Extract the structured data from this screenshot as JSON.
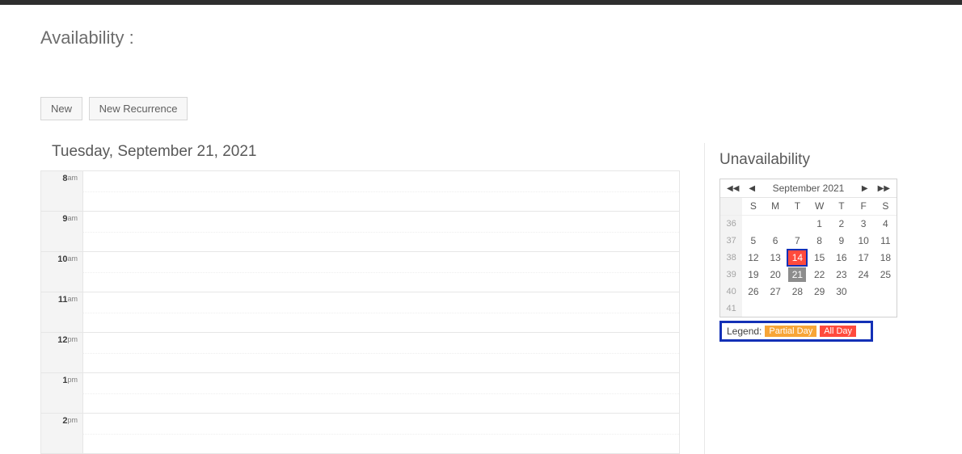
{
  "header": {
    "title": "Availability :"
  },
  "toolbar": {
    "new_label": "New",
    "new_recurrence_label": "New Recurrence"
  },
  "schedule": {
    "date_title": "Tuesday, September 21, 2021",
    "hours": [
      {
        "hour": "8",
        "ampm": "am"
      },
      {
        "hour": "9",
        "ampm": "am"
      },
      {
        "hour": "10",
        "ampm": "am"
      },
      {
        "hour": "11",
        "ampm": "am"
      },
      {
        "hour": "12",
        "ampm": "pm"
      },
      {
        "hour": "1",
        "ampm": "pm"
      },
      {
        "hour": "2",
        "ampm": "pm"
      }
    ]
  },
  "sidebar": {
    "title": "Unavailability",
    "calendar": {
      "title": "September 2021",
      "dow": [
        "S",
        "M",
        "T",
        "W",
        "T",
        "F",
        "S"
      ],
      "weeks": [
        {
          "wk": "36",
          "days": [
            "",
            "",
            "",
            "1",
            "2",
            "3",
            "4"
          ]
        },
        {
          "wk": "37",
          "days": [
            "5",
            "6",
            "7",
            "8",
            "9",
            "10",
            "11"
          ]
        },
        {
          "wk": "38",
          "days": [
            "12",
            "13",
            "14",
            "15",
            "16",
            "17",
            "18"
          ]
        },
        {
          "wk": "39",
          "days": [
            "19",
            "20",
            "21",
            "22",
            "23",
            "24",
            "25"
          ]
        },
        {
          "wk": "40",
          "days": [
            "26",
            "27",
            "28",
            "29",
            "30",
            "",
            ""
          ]
        },
        {
          "wk": "41",
          "days": [
            "",
            "",
            "",
            "",
            "",
            "",
            ""
          ]
        }
      ],
      "selected_day": "21",
      "allday_marked": [
        "14"
      ]
    },
    "legend": {
      "label": "Legend:",
      "partial": "Partial Day",
      "all": "All Day"
    }
  }
}
